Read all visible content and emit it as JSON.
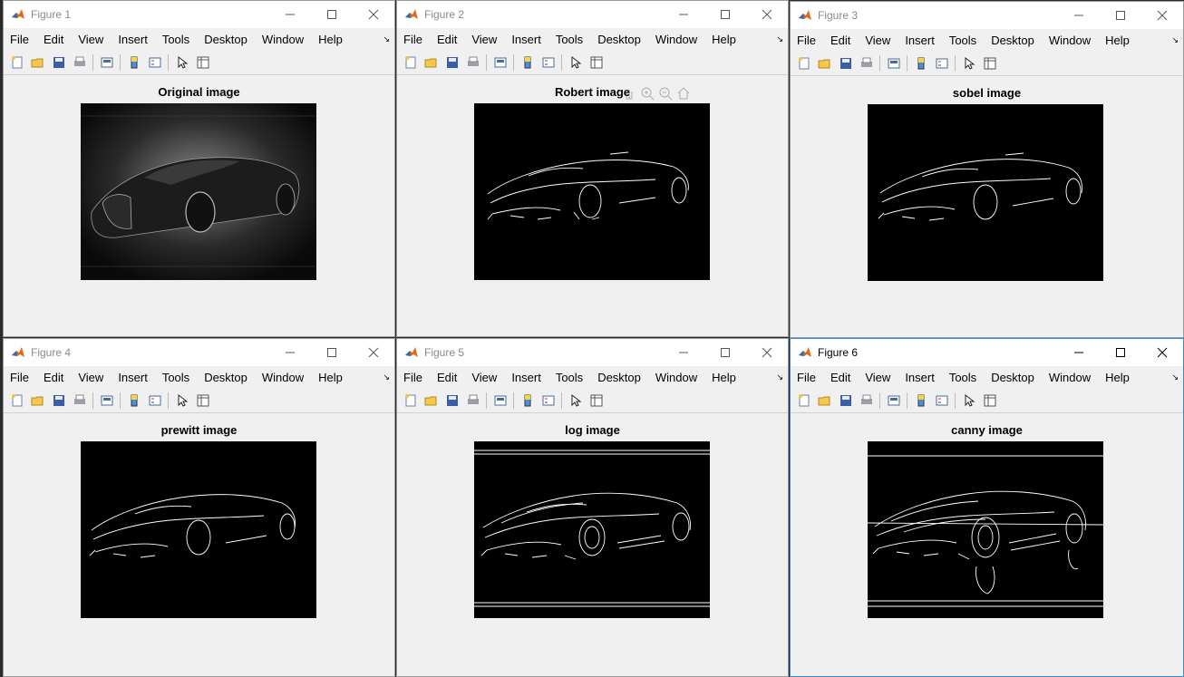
{
  "menus": [
    "File",
    "Edit",
    "View",
    "Insert",
    "Tools",
    "Desktop",
    "Window",
    "Help"
  ],
  "menu_overflow": "↘",
  "toolbar_icons": [
    "new-figure-icon",
    "open-file-icon",
    "save-icon",
    "print-icon",
    "link-plot-icon",
    "insert-colorbar-icon",
    "insert-legend-icon",
    "edit-plot-icon",
    "property-inspector-icon"
  ],
  "figures": [
    {
      "title": "Figure 1",
      "axes_title": "Original image",
      "active": false
    },
    {
      "title": "Figure 2",
      "axes_title": "Robert image",
      "active": false
    },
    {
      "title": "Figure 3",
      "axes_title": "sobel image",
      "active": false
    },
    {
      "title": "Figure 4",
      "axes_title": "prewitt image",
      "active": false
    },
    {
      "title": "Figure 5",
      "axes_title": "log image",
      "active": false
    },
    {
      "title": "Figure 6",
      "axes_title": "canny image",
      "active": true
    }
  ],
  "colors": {
    "window_bg": "#f0f0f0",
    "plot_bg": "#000000",
    "active_border": "#3a8bd6"
  }
}
